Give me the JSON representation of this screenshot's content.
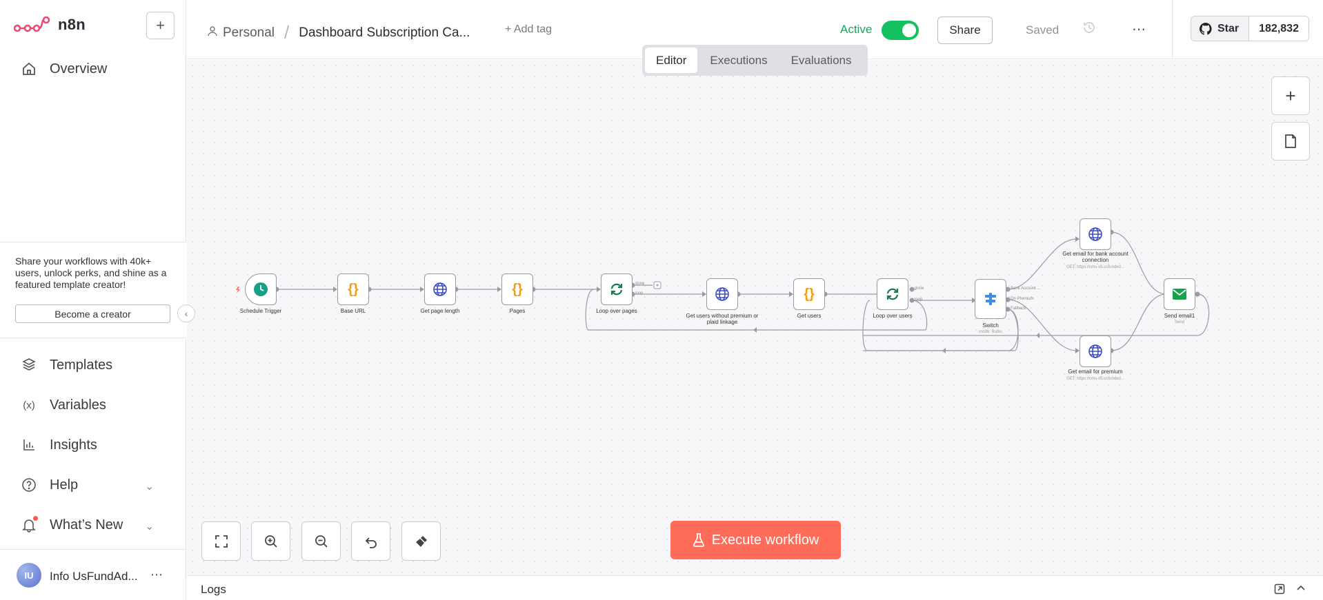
{
  "app": {
    "name": "n8n"
  },
  "sidebar": {
    "new_label": "+",
    "overview": "Overview",
    "promo_text": "Share your workflows with 40k+ users, unlock perks, and shine as a featured template creator!",
    "promo_button": "Become a creator",
    "items": [
      {
        "label": "Templates",
        "icon": "templates-icon"
      },
      {
        "label": "Variables",
        "icon": "variables-icon"
      },
      {
        "label": "Insights",
        "icon": "insights-icon"
      },
      {
        "label": "Help",
        "icon": "help-icon"
      },
      {
        "label": "What’s New",
        "icon": "bell-icon"
      }
    ],
    "user": {
      "initials": "IU",
      "name": "Info UsFundAd..."
    }
  },
  "header": {
    "project": "Personal",
    "workflow_title": "Dashboard Subscription Ca...",
    "add_tag": "+ Add tag",
    "active_label": "Active",
    "share_label": "Share",
    "saved_label": "Saved",
    "star_label": "Star",
    "star_count": "182,832"
  },
  "tabs": [
    "Editor",
    "Executions",
    "Evaluations"
  ],
  "canvas": {
    "nodes": [
      {
        "label": "Schedule Trigger",
        "sub": ""
      },
      {
        "label": "Base URL",
        "sub": ""
      },
      {
        "label": "Get page length",
        "sub": ""
      },
      {
        "label": "Pages",
        "sub": ""
      },
      {
        "label": "Loop over pages",
        "sub": ""
      },
      {
        "label": "Get users without premium or plaid linkage",
        "sub": ""
      },
      {
        "label": "Get users",
        "sub": ""
      },
      {
        "label": "Loop over users",
        "sub": ""
      },
      {
        "label": "Switch",
        "sub": "mode: Rules"
      },
      {
        "label": "Get email for bank account connection",
        "sub": "GET: https://cms-v5.usfunded..."
      },
      {
        "label": "Get email for premium",
        "sub": "GET: https://cms-v5.usfunded..."
      },
      {
        "label": "Send email1",
        "sub": "Send"
      }
    ],
    "ports": {
      "loop_pages_done": "done",
      "loop_pages_loop": "loop",
      "loop_users_done": "done",
      "loop_users_loop": "loop",
      "switch_1": "Bank Account ...",
      "switch_2": "On Premium",
      "switch_3": "Fallback"
    },
    "execute_label": "Execute workflow"
  },
  "logs": {
    "label": "Logs"
  },
  "colors": {
    "accent": "#ff6d5a",
    "active": "#13c25f",
    "brand": "#ea4b71"
  }
}
